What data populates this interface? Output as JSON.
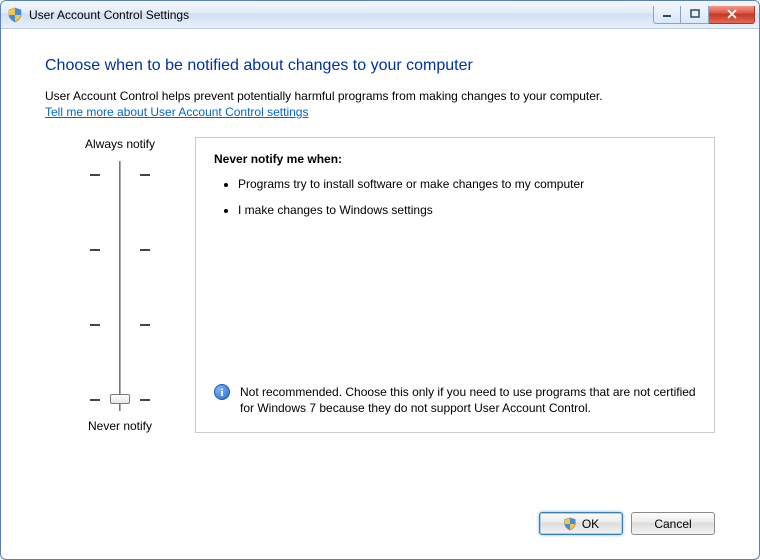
{
  "window": {
    "title": "User Account Control Settings"
  },
  "heading": "Choose when to be notified about changes to your computer",
  "description": "User Account Control helps prevent potentially harmful programs from making changes to your computer.",
  "help_link": "Tell me more about User Account Control settings",
  "slider": {
    "top_label": "Always notify",
    "bottom_label": "Never notify",
    "levels": 4,
    "current_level": 0
  },
  "panel": {
    "title": "Never notify me when:",
    "bullets": [
      "Programs try to install software or make changes to my computer",
      "I make changes to Windows settings"
    ],
    "recommendation": "Not recommended. Choose this only if you need to use programs that are not certified for Windows 7 because they do not support User Account Control."
  },
  "buttons": {
    "ok": "OK",
    "cancel": "Cancel"
  }
}
